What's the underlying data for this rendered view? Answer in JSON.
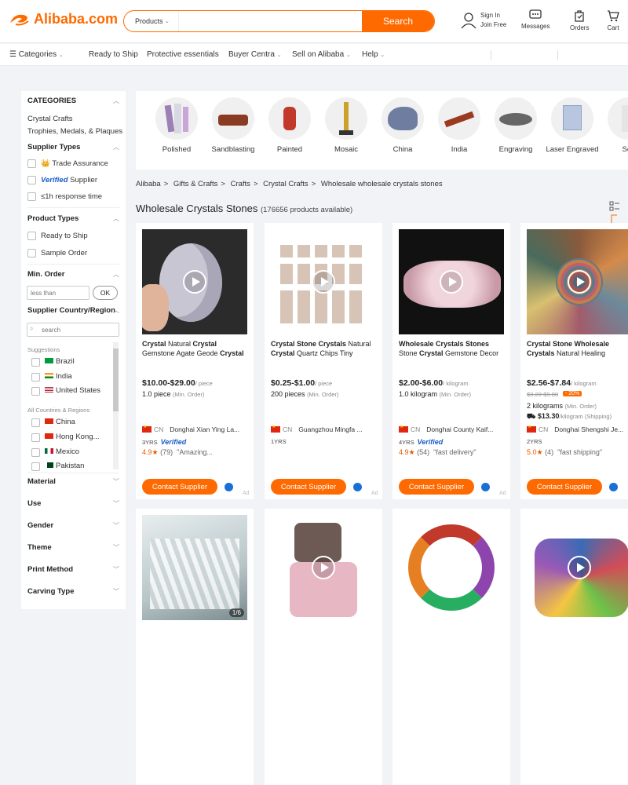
{
  "header": {
    "logo": "Alibaba.com",
    "search_category": "Products",
    "search_placeholder": "",
    "search_button": "Search",
    "sign_in": "Sign In",
    "join_free": "Join Free",
    "messages": "Messages",
    "orders": "Orders",
    "cart": "Cart"
  },
  "nav": {
    "categories": "Categories",
    "items": [
      "Ready to Ship",
      "Protective essentials",
      "Buyer Centra",
      "Sell on Alibaba",
      "Help"
    ]
  },
  "sidebar": {
    "categories_title": "CATEGORIES",
    "categories": [
      "Crystal Crafts",
      "Trophies, Medals, & Plaques"
    ],
    "supplier_types_title": "Supplier Types",
    "trade_assurance": "Trade Assurance",
    "verified_word": "Verified",
    "supplier": "Supplier",
    "response": "≤1h response time",
    "product_types_title": "Product Types",
    "product_types": [
      "Ready to Ship",
      "Sample Order"
    ],
    "min_order_title": "Min. Order",
    "min_order_placeholder": "less than",
    "ok": "OK",
    "country_title": "Supplier Country/Region",
    "country_search_placeholder": "search",
    "suggestions_label": "Suggestions",
    "suggestions": [
      "Brazil",
      "India",
      "United States"
    ],
    "all_label": "All Countries & Regions",
    "all_countries": [
      "China",
      "Hong Kong...",
      "Mexico",
      "Pakistan"
    ],
    "filters": [
      "Material",
      "Use",
      "Gender",
      "Theme",
      "Print Method",
      "Carving Type"
    ]
  },
  "categories_bar": [
    "Polished",
    "Sandblasting",
    "Painted",
    "Mosaic",
    "China",
    "India",
    "Engraving",
    "Laser Engraved",
    "Sou"
  ],
  "breadcrumb": [
    "Alibaba",
    "Gifts & Crafts",
    "Crafts",
    "Crystal Crafts",
    "Wholesale wholesale crystals stones"
  ],
  "results": {
    "title": "Wholesale Crystals Stones",
    "count": "(176656 products available)"
  },
  "cards": [
    {
      "title_parts": [
        [
          "Crystal",
          1
        ],
        [
          " Natural ",
          0
        ],
        [
          "Crystal",
          1
        ],
        [
          " Gemstone Agate Geode ",
          0
        ],
        [
          "Crystal",
          1
        ]
      ],
      "price": "$10.00-$29.00",
      "unit": "/ piece",
      "old_price": "",
      "discount": "",
      "min": "1.0 piece",
      "min_label": "(Min. Order)",
      "shipping": "",
      "country": "CN",
      "supplier": "Donghai Xian Ying La...",
      "years": "3YRS",
      "verified": "Verified",
      "rating": "4.9★",
      "reviews": "(79)",
      "review": "\"Amazing...",
      "button": "Contact Supplier",
      "ad": "Ad"
    },
    {
      "title_parts": [
        [
          "Crystal Stone Crystals",
          1
        ],
        [
          " Natural ",
          0
        ],
        [
          "Crystal",
          1
        ],
        [
          " Quartz Chips Tiny",
          0
        ]
      ],
      "price": "$0.25-$1.00",
      "unit": "/ piece",
      "old_price": "",
      "discount": "",
      "min": "200 pieces",
      "min_label": "(Min. Order)",
      "shipping": "",
      "country": "CN",
      "supplier": "Guangzhou Mingfa ...",
      "years": "1YRS",
      "verified": "",
      "rating": "",
      "reviews": "",
      "review": "",
      "button": "Contact Supplier",
      "ad": "Ad"
    },
    {
      "title_parts": [
        [
          "Wholesale Crystals Stones",
          1
        ],
        [
          " Stone ",
          0
        ],
        [
          "Crystal",
          1
        ],
        [
          " Gemstone Decor",
          0
        ]
      ],
      "price": "$2.00-$6.00",
      "unit": "/ kilogram",
      "old_price": "",
      "discount": "",
      "min": "1.0 kilogram",
      "min_label": "(Min. Order)",
      "shipping": "",
      "country": "CN",
      "supplier": "Donghai County Kaif...",
      "years": "4YRS",
      "verified": "Verified",
      "rating": "4.9★",
      "reviews": "(54)",
      "review": "\"fast delivery\"",
      "button": "Contact Supplier",
      "ad": "Ad"
    },
    {
      "title_parts": [
        [
          "Crystal Stone Wholesale Crystals",
          1
        ],
        [
          " Natural Healing",
          0
        ]
      ],
      "price": "$2.56-$7.84",
      "unit": "/ kilogram",
      "old_price": "$3.20-$9.80",
      "discount": "- 20%",
      "min": "2 kilograms",
      "min_label": "(Min. Order)",
      "shipping": "$13.30",
      "shipping_unit": "/kilogram (Shipping)",
      "country": "CN",
      "supplier": "Donghai Shengshi Je...",
      "years": "2YRS",
      "verified": "",
      "rating": "5.0★",
      "reviews": "(4)",
      "review": "\"fast shipping\"",
      "button": "Contact Supplier",
      "ad": ""
    }
  ],
  "row2_badge": "1/6",
  "colors": {
    "accent": "#ff6a00",
    "verified": "#1a5dc7"
  }
}
